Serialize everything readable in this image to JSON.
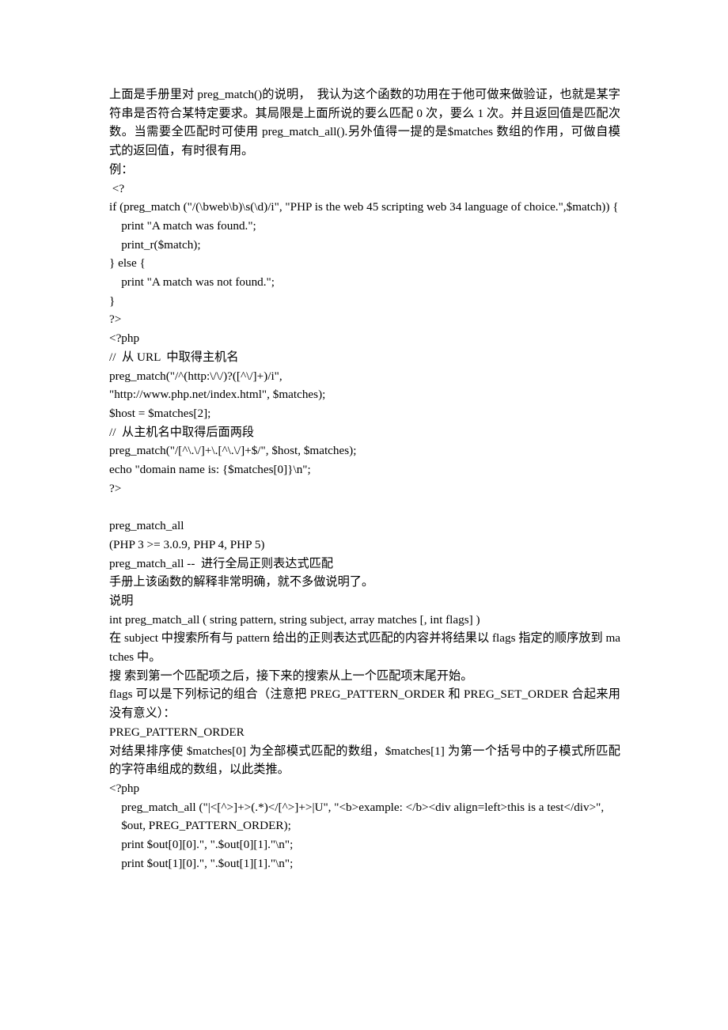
{
  "document": {
    "language": "zh-CN",
    "intro_paragraph": "上面是手册里对 preg_match()的说明，  我认为这个函数的功用在于他可做来做验证，也就是某字符串是否符合某特定要求。其局限是上面所说的要么匹配 0 次，要么 1 次。并且返回值是匹配次数。当需要全匹配时可使用 preg_match_all().另外值得一提的是$matches 数组的作用，可做自模 式的返回值，有时很有用。",
    "example_label": "例：",
    "code_block_1": [
      " <?",
      "if (preg_match (\"/(\\bweb\\b)\\s(\\d)/i\", \"PHP is the web 45 scripting web 34 language of choice.\",$match)) {",
      "    print \"A match was found.\";",
      "    print_r($match);",
      "} else {",
      "    print \"A match was not found.\";",
      "}",
      "?>"
    ],
    "code_block_2": [
      "<?php",
      "//  从 URL  中取得主机名",
      "preg_match(\"/^(http:\\/\\/)?([^\\/]+)/i\",",
      "\"http://www.php.net/index.html\", $matches);",
      "$host = $matches[2];",
      "//  从主机名中取得后面两段",
      "preg_match(\"/[^\\.\\/]+\\.[^\\.\\/]+$/\", $host, $matches);",
      "echo \"domain name is: {$matches[0]}\\n\";",
      "?>"
    ],
    "section_title": "preg_match_all",
    "version_line": "(PHP 3 >= 3.0.9, PHP 4, PHP 5)",
    "summary_line": "preg_match_all --  进行全局正则表达式匹配",
    "manual_note": "手册上该函数的解释非常明确，就不多做说明了。",
    "description_heading": "说明",
    "signature": "int preg_match_all ( string pattern, string subject, array matches [, int flags] )",
    "description_paragraph": "在 subject 中搜索所有与 pattern 给出的正则表达式匹配的内容并将结果以 flags 指定的顺序放到 matches 中。",
    "search_note": "搜 索到第一个匹配项之后，接下来的搜索从上一个匹配项末尾开始。",
    "flags_paragraph": "flags 可以是下列标记的组合（注意把 PREG_PATTERN_ORDER 和 PREG_SET_ORDER 合起来用没有意义）：",
    "flag_name": "PREG_PATTERN_ORDER",
    "flag_description": "对结果排序使 $matches[0] 为全部模式匹配的数组，$matches[1] 为第一个括号中的子模式所匹配的字符串组成的数组，以此类推。",
    "code_block_3": [
      "<?php",
      "    preg_match_all (\"|<[^>]+>(.*)</[^>]+>|U\", \"<b>example: </b><div align=left>this is a test</div>\",",
      "    $out, PREG_PATTERN_ORDER);",
      "    print $out[0][0].\", \".$out[0][1].\"\\n\";",
      "    print $out[1][0].\", \".$out[1][1].\"\\n\";"
    ]
  }
}
